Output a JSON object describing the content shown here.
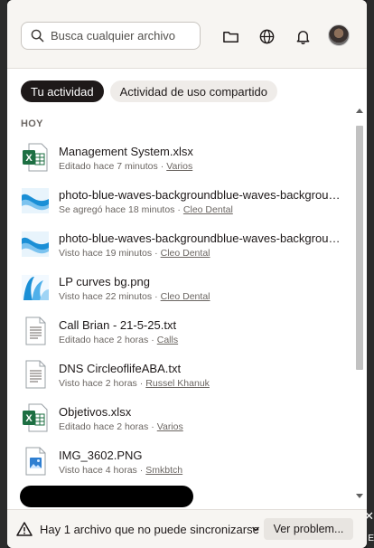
{
  "header": {
    "search_placeholder": "Busca cualquier archivo",
    "icons": [
      "search-icon",
      "folder-icon",
      "globe-icon",
      "bell-icon"
    ]
  },
  "tabs": [
    {
      "label": "Tu actividad",
      "active": true
    },
    {
      "label": "Actividad de uso compartido",
      "active": false
    }
  ],
  "section": {
    "label": "HOY"
  },
  "items": [
    {
      "name": "Management System.xlsx",
      "action": "Editado hace 7 minutos",
      "location": "Varios",
      "icon": "excel"
    },
    {
      "name": "photo-blue-waves-backgroundblue-waves-background",
      "action": "Se agregó hace 18 minutos",
      "location": "Cleo Dental",
      "icon": "image-wave"
    },
    {
      "name": "photo-blue-waves-backgroundblue-waves-background",
      "action": "Visto hace 19 minutos",
      "location": "Cleo Dental",
      "icon": "image-wave"
    },
    {
      "name": "LP curves bg.png",
      "action": "Visto hace 22 minutos",
      "location": "Cleo Dental",
      "icon": "image-curve"
    },
    {
      "name": "Call Brian - 21-5-25.txt",
      "action": "Editado hace 2 horas",
      "location": "Calls",
      "icon": "text"
    },
    {
      "name": "DNS CircleoflifeABA.txt",
      "action": "Visto hace 2 horas",
      "location": "Russel Khanuk",
      "icon": "text"
    },
    {
      "name": "Objetivos.xlsx",
      "action": "Editado hace 2 horas",
      "location": "Varios",
      "icon": "excel"
    },
    {
      "name": "IMG_3602.PNG",
      "action": "Visto hace 4 horas",
      "location": "Smkbtch",
      "icon": "image"
    }
  ],
  "footer": {
    "message": "Hay 1 archivo que no puede sincronizarse",
    "button_label": "Ver problem..."
  },
  "colors": {
    "accent_dark": "#1e1919",
    "excel_green": "#1d6f42",
    "wave_blue": "#1a8fd6"
  }
}
